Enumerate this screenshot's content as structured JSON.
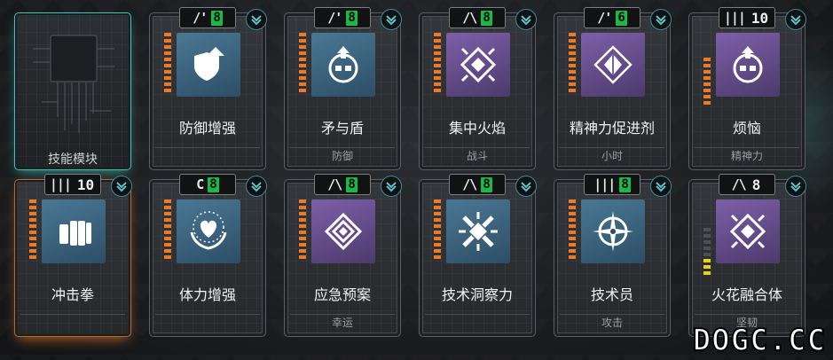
{
  "watermark": "DOGC.CC",
  "cards": [
    {
      "id": "skill-module",
      "title": "技能模块",
      "special": true,
      "glow": "teal"
    },
    {
      "id": "defense-boost",
      "title": "防御增强",
      "badge_type": "/'",
      "level": "8",
      "art": "blue",
      "icon": "shield-up-icon",
      "bars": 10,
      "footer": ""
    },
    {
      "id": "spear-shield",
      "title": "矛与盾",
      "badge_type": "/'",
      "level": "8",
      "art": "blue",
      "icon": "mask-up-icon",
      "bars": 10,
      "footer": "防御"
    },
    {
      "id": "focus-flame",
      "title": "集中火焰",
      "badge_type": "/\\",
      "level": "8",
      "art": "purple",
      "icon": "diamond-cross-icon",
      "bars": 10,
      "footer": "战斗"
    },
    {
      "id": "spirit-stim",
      "title": "精神力促进剂",
      "badge_type": "/'",
      "level": "6",
      "art": "purple",
      "icon": "diamond-gem-icon",
      "bars": 10,
      "footer": "小时"
    },
    {
      "id": "worry",
      "title": "烦恼",
      "badge_type": "|||",
      "level": "10",
      "art": "purple",
      "icon": "mask-up-icon",
      "bars": 8,
      "footer": "精神力"
    },
    {
      "id": "strike-fist",
      "title": "冲击拳",
      "badge_type": "|||",
      "level": "10",
      "art": "blue",
      "icon": "fist-icon",
      "bars": 10,
      "footer": "",
      "glow": "orange"
    },
    {
      "id": "stamina-boost",
      "title": "体力增强",
      "badge_type": "C",
      "level": "8",
      "art": "blue",
      "icon": "heart-hands-icon",
      "bars": 10,
      "footer": ""
    },
    {
      "id": "emergency-plan",
      "title": "应急预案",
      "badge_type": "/\\",
      "level": "8",
      "art": "purple",
      "icon": "diamond-nest-icon",
      "bars": 10,
      "footer": "幸运"
    },
    {
      "id": "tech-insight",
      "title": "技术洞察力",
      "badge_type": "/\\",
      "level": "8",
      "art": "blue",
      "icon": "cross-diamond-icon",
      "bars": 10,
      "footer": ""
    },
    {
      "id": "technician",
      "title": "技术员",
      "badge_type": "|||",
      "level": "8",
      "art": "blue",
      "icon": "compass-icon",
      "bars": 10,
      "footer": "攻击"
    },
    {
      "id": "spark-fusion",
      "title": "火花融合体",
      "badge_type": "/\\",
      "level": "8",
      "art": "purple",
      "icon": "diamond-cross-icon",
      "bars": 8,
      "footer": "坚韧"
    }
  ]
}
